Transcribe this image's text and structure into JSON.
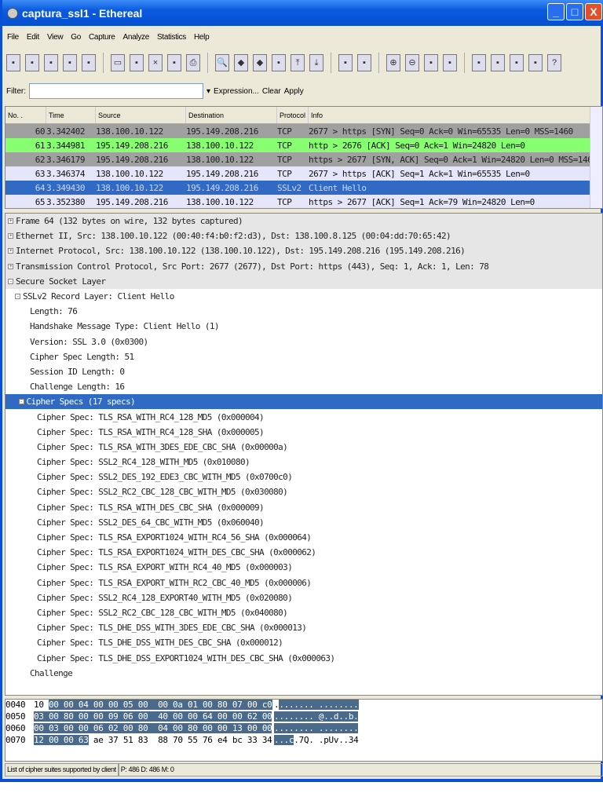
{
  "window": {
    "title": "captura_ssl1 - Ethereal",
    "min": "_",
    "max": "□",
    "close": "X"
  },
  "menu": [
    "File",
    "Edit",
    "View",
    "Go",
    "Capture",
    "Analyze",
    "Statistics",
    "Help"
  ],
  "toolbar": [
    "interfaces",
    "options",
    "start",
    "stop",
    "restart",
    "open",
    "save",
    "close",
    "reload",
    "print",
    "find",
    "back",
    "forward",
    "goto",
    "first",
    "last",
    "colorize",
    "autoscroll",
    "zoom-in",
    "zoom-out",
    "zoom-normal",
    "resize",
    "capture-filters",
    "display-filters",
    "coloring-rules",
    "preferences",
    "help"
  ],
  "filter": {
    "label": "Filter:",
    "value": "",
    "expression": "Expression...",
    "clear": "Clear",
    "apply": "Apply"
  },
  "packet_list": {
    "columns": [
      "No. .",
      "Time",
      "Source",
      "Destination",
      "Protocol",
      "Info"
    ],
    "rows": [
      {
        "no": "60",
        "time": "3.342402",
        "src": "138.100.10.122",
        "dst": "195.149.208.216",
        "proto": "TCP",
        "info": "2677 > https [SYN] Seq=0 Ack=0 Win=65535 Len=0 MSS=1460",
        "bg": "#a0a0a0",
        "fg": "#222"
      },
      {
        "no": "61",
        "time": "3.344981",
        "src": "195.149.208.216",
        "dst": "138.100.10.122",
        "proto": "TCP",
        "info": "http > 2676 [ACK] Seq=0 Ack=1 Win=24820 Len=0",
        "bg": "#88ff70",
        "fg": "#111"
      },
      {
        "no": "62",
        "time": "3.346179",
        "src": "195.149.208.216",
        "dst": "138.100.10.122",
        "proto": "TCP",
        "info": "https > 2677 [SYN, ACK] Seq=0 Ack=1 Win=24820 Len=0 MSS=1460",
        "bg": "#a0a0a0",
        "fg": "#222"
      },
      {
        "no": "63",
        "time": "3.346374",
        "src": "138.100.10.122",
        "dst": "195.149.208.216",
        "proto": "TCP",
        "info": "2677 > https [ACK] Seq=1 Ack=1 Win=65535 Len=0",
        "bg": "#e6e6fa",
        "fg": "#111"
      },
      {
        "no": "64",
        "time": "3.349430",
        "src": "138.100.10.122",
        "dst": "195.149.208.216",
        "proto": "SSLv2",
        "info": "Client Hello",
        "bg": "#316ac5",
        "fg": "#c8d8ff"
      },
      {
        "no": "65",
        "time": "3.352380",
        "src": "195.149.208.216",
        "dst": "138.100.10.122",
        "proto": "TCP",
        "info": "https > 2677 [ACK] Seq=1 Ack=79 Win=24820 Len=0",
        "bg": "#e6e6fa",
        "fg": "#111"
      }
    ]
  },
  "details": [
    {
      "t": "Frame 64 (132 bytes on wire, 132 bytes captured)",
      "lvl": 0,
      "exp": "+",
      "cls": "top"
    },
    {
      "t": "Ethernet II, Src: 138.100.10.122 (00:40:f4:b0:f2:d3), Dst: 138.100.8.125 (00:04:dd:70:65:42)",
      "lvl": 0,
      "exp": "+",
      "cls": "top"
    },
    {
      "t": "Internet Protocol, Src: 138.100.10.122 (138.100.10.122), Dst: 195.149.208.216 (195.149.208.216)",
      "lvl": 0,
      "exp": "+",
      "cls": "top"
    },
    {
      "t": "Transmission Control Protocol, Src Port: 2677 (2677), Dst Port: https (443), Seq: 1, Ack: 1, Len: 78",
      "lvl": 0,
      "exp": "+",
      "cls": "top"
    },
    {
      "t": "Secure Socket Layer",
      "lvl": 0,
      "exp": "-",
      "cls": "top"
    },
    {
      "t": "SSLv2 Record Layer: Client Hello",
      "lvl": 1,
      "exp": "-",
      "cls": ""
    },
    {
      "t": "Length: 76",
      "lvl": 2,
      "exp": "",
      "cls": ""
    },
    {
      "t": "Handshake Message Type: Client Hello (1)",
      "lvl": 2,
      "exp": "",
      "cls": ""
    },
    {
      "t": "Version: SSL 3.0 (0x0300)",
      "lvl": 2,
      "exp": "",
      "cls": ""
    },
    {
      "t": "Cipher Spec Length: 51",
      "lvl": 2,
      "exp": "",
      "cls": ""
    },
    {
      "t": "Session ID Length: 0",
      "lvl": 2,
      "exp": "",
      "cls": ""
    },
    {
      "t": "Challenge Length: 16",
      "lvl": 2,
      "exp": "",
      "cls": ""
    },
    {
      "t": "Cipher Specs (17 specs)",
      "lvl": 1.5,
      "exp": "-",
      "cls": "sel"
    },
    {
      "t": "Cipher Spec: TLS_RSA_WITH_RC4_128_MD5 (0x000004)",
      "lvl": 3,
      "exp": "",
      "cls": ""
    },
    {
      "t": "Cipher Spec: TLS_RSA_WITH_RC4_128_SHA (0x000005)",
      "lvl": 3,
      "exp": "",
      "cls": ""
    },
    {
      "t": "Cipher Spec: TLS_RSA_WITH_3DES_EDE_CBC_SHA (0x00000a)",
      "lvl": 3,
      "exp": "",
      "cls": ""
    },
    {
      "t": "Cipher Spec: SSL2_RC4_128_WITH_MD5 (0x010080)",
      "lvl": 3,
      "exp": "",
      "cls": ""
    },
    {
      "t": "Cipher Spec: SSL2_DES_192_EDE3_CBC_WITH_MD5 (0x0700c0)",
      "lvl": 3,
      "exp": "",
      "cls": ""
    },
    {
      "t": "Cipher Spec: SSL2_RC2_CBC_128_CBC_WITH_MD5 (0x030080)",
      "lvl": 3,
      "exp": "",
      "cls": ""
    },
    {
      "t": "Cipher Spec: TLS_RSA_WITH_DES_CBC_SHA (0x000009)",
      "lvl": 3,
      "exp": "",
      "cls": ""
    },
    {
      "t": "Cipher Spec: SSL2_DES_64_CBC_WITH_MD5 (0x060040)",
      "lvl": 3,
      "exp": "",
      "cls": ""
    },
    {
      "t": "Cipher Spec: TLS_RSA_EXPORT1024_WITH_RC4_56_SHA (0x000064)",
      "lvl": 3,
      "exp": "",
      "cls": ""
    },
    {
      "t": "Cipher Spec: TLS_RSA_EXPORT1024_WITH_DES_CBC_SHA (0x000062)",
      "lvl": 3,
      "exp": "",
      "cls": ""
    },
    {
      "t": "Cipher Spec: TLS_RSA_EXPORT_WITH_RC4_40_MD5 (0x000003)",
      "lvl": 3,
      "exp": "",
      "cls": ""
    },
    {
      "t": "Cipher Spec: TLS_RSA_EXPORT_WITH_RC2_CBC_40_MD5 (0x000006)",
      "lvl": 3,
      "exp": "",
      "cls": ""
    },
    {
      "t": "Cipher Spec: SSL2_RC4_128_EXPORT40_WITH_MD5 (0x020080)",
      "lvl": 3,
      "exp": "",
      "cls": ""
    },
    {
      "t": "Cipher Spec: SSL2_RC2_CBC_128_CBC_WITH_MD5 (0x040080)",
      "lvl": 3,
      "exp": "",
      "cls": ""
    },
    {
      "t": "Cipher Spec: TLS_DHE_DSS_WITH_3DES_EDE_CBC_SHA (0x000013)",
      "lvl": 3,
      "exp": "",
      "cls": ""
    },
    {
      "t": "Cipher Spec: TLS_DHE_DSS_WITH_DES_CBC_SHA (0x000012)",
      "lvl": 3,
      "exp": "",
      "cls": ""
    },
    {
      "t": "Cipher Spec: TLS_DHE_DSS_EXPORT1024_WITH_DES_CBC_SHA (0x000063)",
      "lvl": 3,
      "exp": "",
      "cls": ""
    },
    {
      "t": "Challenge",
      "lvl": 2,
      "exp": "",
      "cls": ""
    }
  ],
  "hex": [
    {
      "off": "0040",
      "pre": "10 ",
      "hl": "00 00 04 00 00 05 00  00 0a 01 00 80 07 00 c0",
      "post": "",
      "apre": ".",
      "ahl": "....... ........",
      "apost": ""
    },
    {
      "off": "0050",
      "pre": "",
      "hl": "03 00 80 00 00 09 06 00  40 00 00 64 00 00 62 00",
      "post": "",
      "apre": "",
      "ahl": "........ @..d..b.",
      "apost": ""
    },
    {
      "off": "0060",
      "pre": "",
      "hl": "00 03 00 00 06 02 00 80  04 00 80 00 00 13 00 00",
      "post": "",
      "apre": "",
      "ahl": "........ ........",
      "apost": ""
    },
    {
      "off": "0070",
      "pre": "",
      "hl": "12 00 00 63",
      "post": " ae 37 51 83  88 70 55 76 e4 bc 33 34",
      "apre": "",
      "ahl": "...c",
      "apost": ".7Q. .pUv..34"
    }
  ],
  "status": {
    "message": "List of cipher suites supported by client",
    "counts": "P: 486 D: 486 M: 0"
  }
}
